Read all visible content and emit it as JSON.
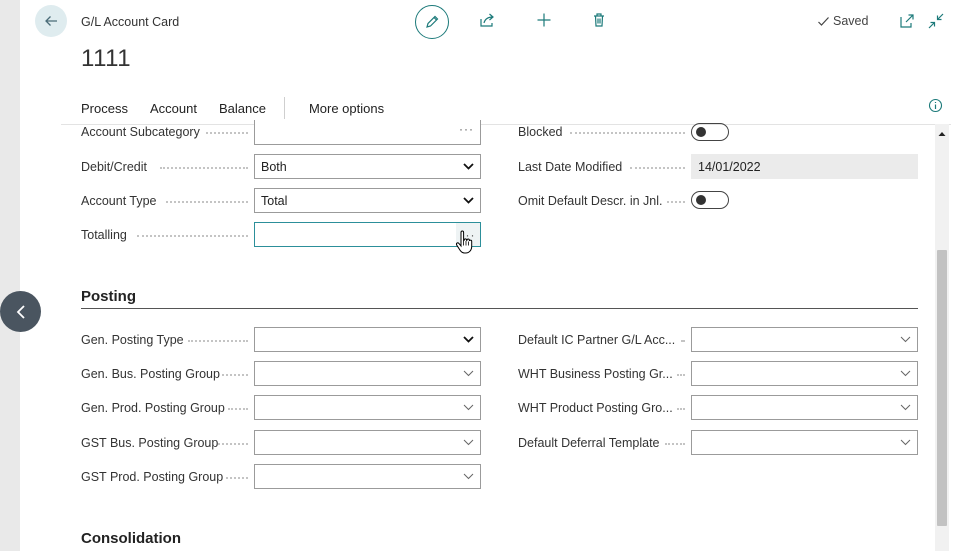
{
  "header": {
    "caption": "G/L Account Card",
    "record_no": "1111",
    "saved_label": "Saved"
  },
  "icons": {
    "back": "arrow-left-icon",
    "edit": "pencil-icon",
    "share": "share-icon",
    "add": "plus-icon",
    "delete": "trash-icon",
    "saved": "checkmark-icon",
    "popout": "open-new-window-icon",
    "collapse": "collapse-icon",
    "info": "info-icon",
    "nav": "chevron-left-icon"
  },
  "action_bar": {
    "items": [
      "Process",
      "Account",
      "Balance"
    ],
    "more": "More options"
  },
  "general": {
    "left": [
      {
        "label": "Account Subcategory",
        "value": "",
        "kind": "lookup"
      },
      {
        "label": "Debit/Credit",
        "value": "Both",
        "kind": "select"
      },
      {
        "label": "Account Type",
        "value": "Total",
        "kind": "select"
      },
      {
        "label": "Totalling",
        "value": "",
        "kind": "lookup-focused"
      }
    ],
    "right": [
      {
        "label": "Blocked",
        "value": false,
        "kind": "toggle"
      },
      {
        "label": "Last Date Modified",
        "value": "14/01/2022",
        "kind": "readonly"
      },
      {
        "label": "Omit Default Descr. in Jnl.",
        "value": false,
        "kind": "toggle"
      }
    ]
  },
  "posting": {
    "title": "Posting",
    "left": [
      {
        "label": "Gen. Posting Type",
        "value": ""
      },
      {
        "label": "Gen. Bus. Posting Group",
        "value": ""
      },
      {
        "label": "Gen. Prod. Posting Group",
        "value": ""
      },
      {
        "label": "GST Bus. Posting Group",
        "value": ""
      },
      {
        "label": "GST Prod. Posting Group",
        "value": ""
      }
    ],
    "right": [
      {
        "label": "Default IC Partner G/L Acc...",
        "value": ""
      },
      {
        "label": "WHT Business Posting Gr...",
        "value": ""
      },
      {
        "label": "WHT Product Posting Gro...",
        "value": ""
      },
      {
        "label": "Default Deferral Template",
        "value": ""
      }
    ]
  },
  "consolidation": {
    "title": "Consolidation"
  },
  "colors": {
    "accent": "#1c7a7a",
    "focus": "#2c8f9a",
    "nav_button": "#4a5560",
    "back_button_bg": "#dfecef"
  }
}
